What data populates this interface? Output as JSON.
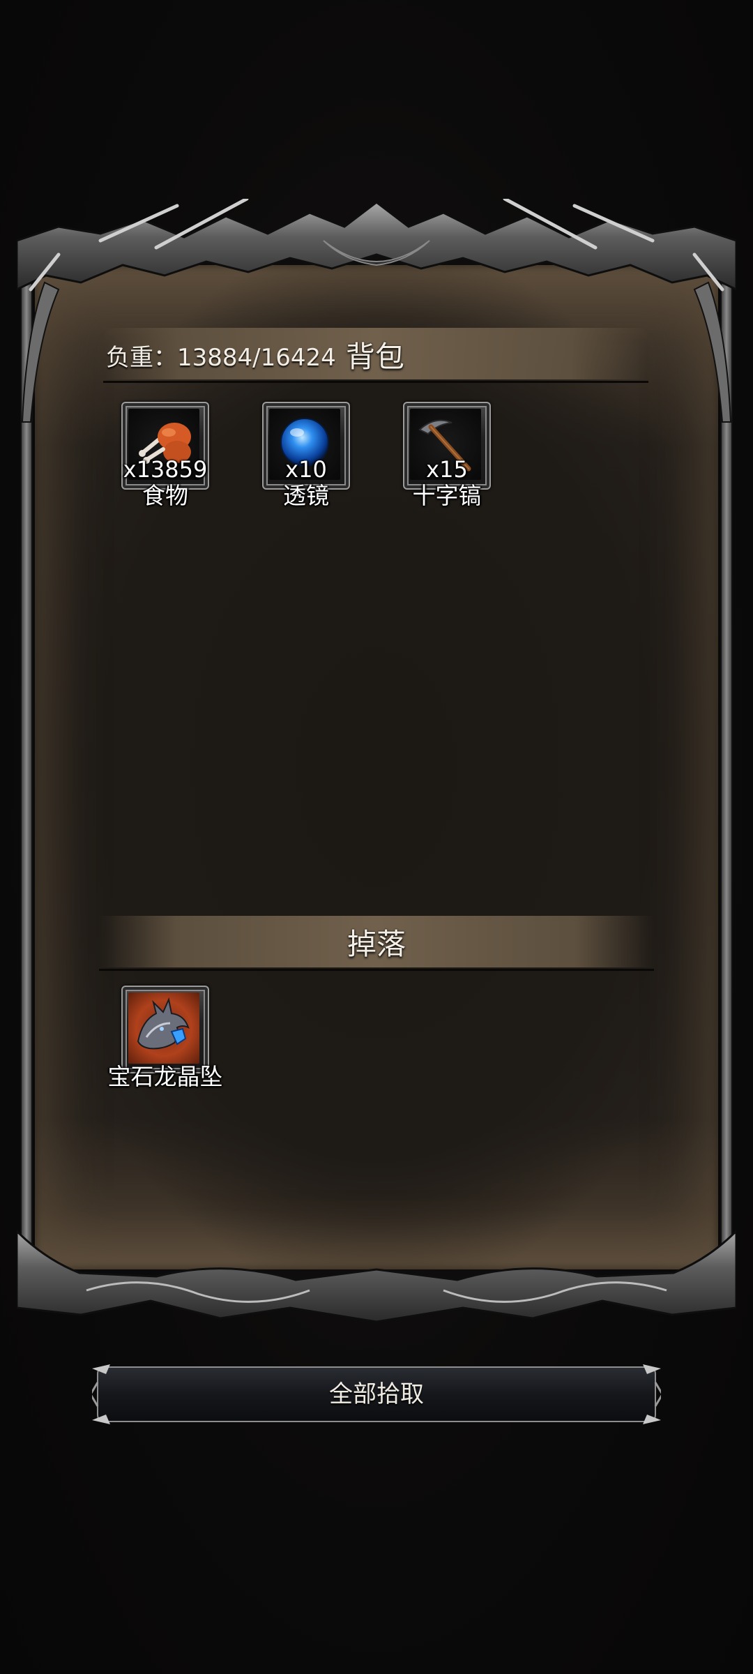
{
  "bag": {
    "weight_label": "负重：",
    "weight_value": "13884/16424",
    "title": "背包",
    "items": [
      {
        "name": "食物",
        "qty": "x13859",
        "icon": "food-drumstick-icon"
      },
      {
        "name": "透镜",
        "qty": "x10",
        "icon": "blue-lens-orb-icon"
      },
      {
        "name": "十字镐",
        "qty": "x15",
        "icon": "pickaxe-icon"
      }
    ]
  },
  "drop": {
    "title": "掉落",
    "items": [
      {
        "name": "宝石龙晶坠",
        "icon": "dragon-crystal-pendant-icon",
        "rarity_color": "#b0411c"
      }
    ]
  },
  "actions": {
    "pickup_all_label": "全部拾取"
  },
  "colors": {
    "panel_bg": "#1f1b17",
    "header_band": "#706050",
    "frame_metal": "#8c8c8c"
  }
}
